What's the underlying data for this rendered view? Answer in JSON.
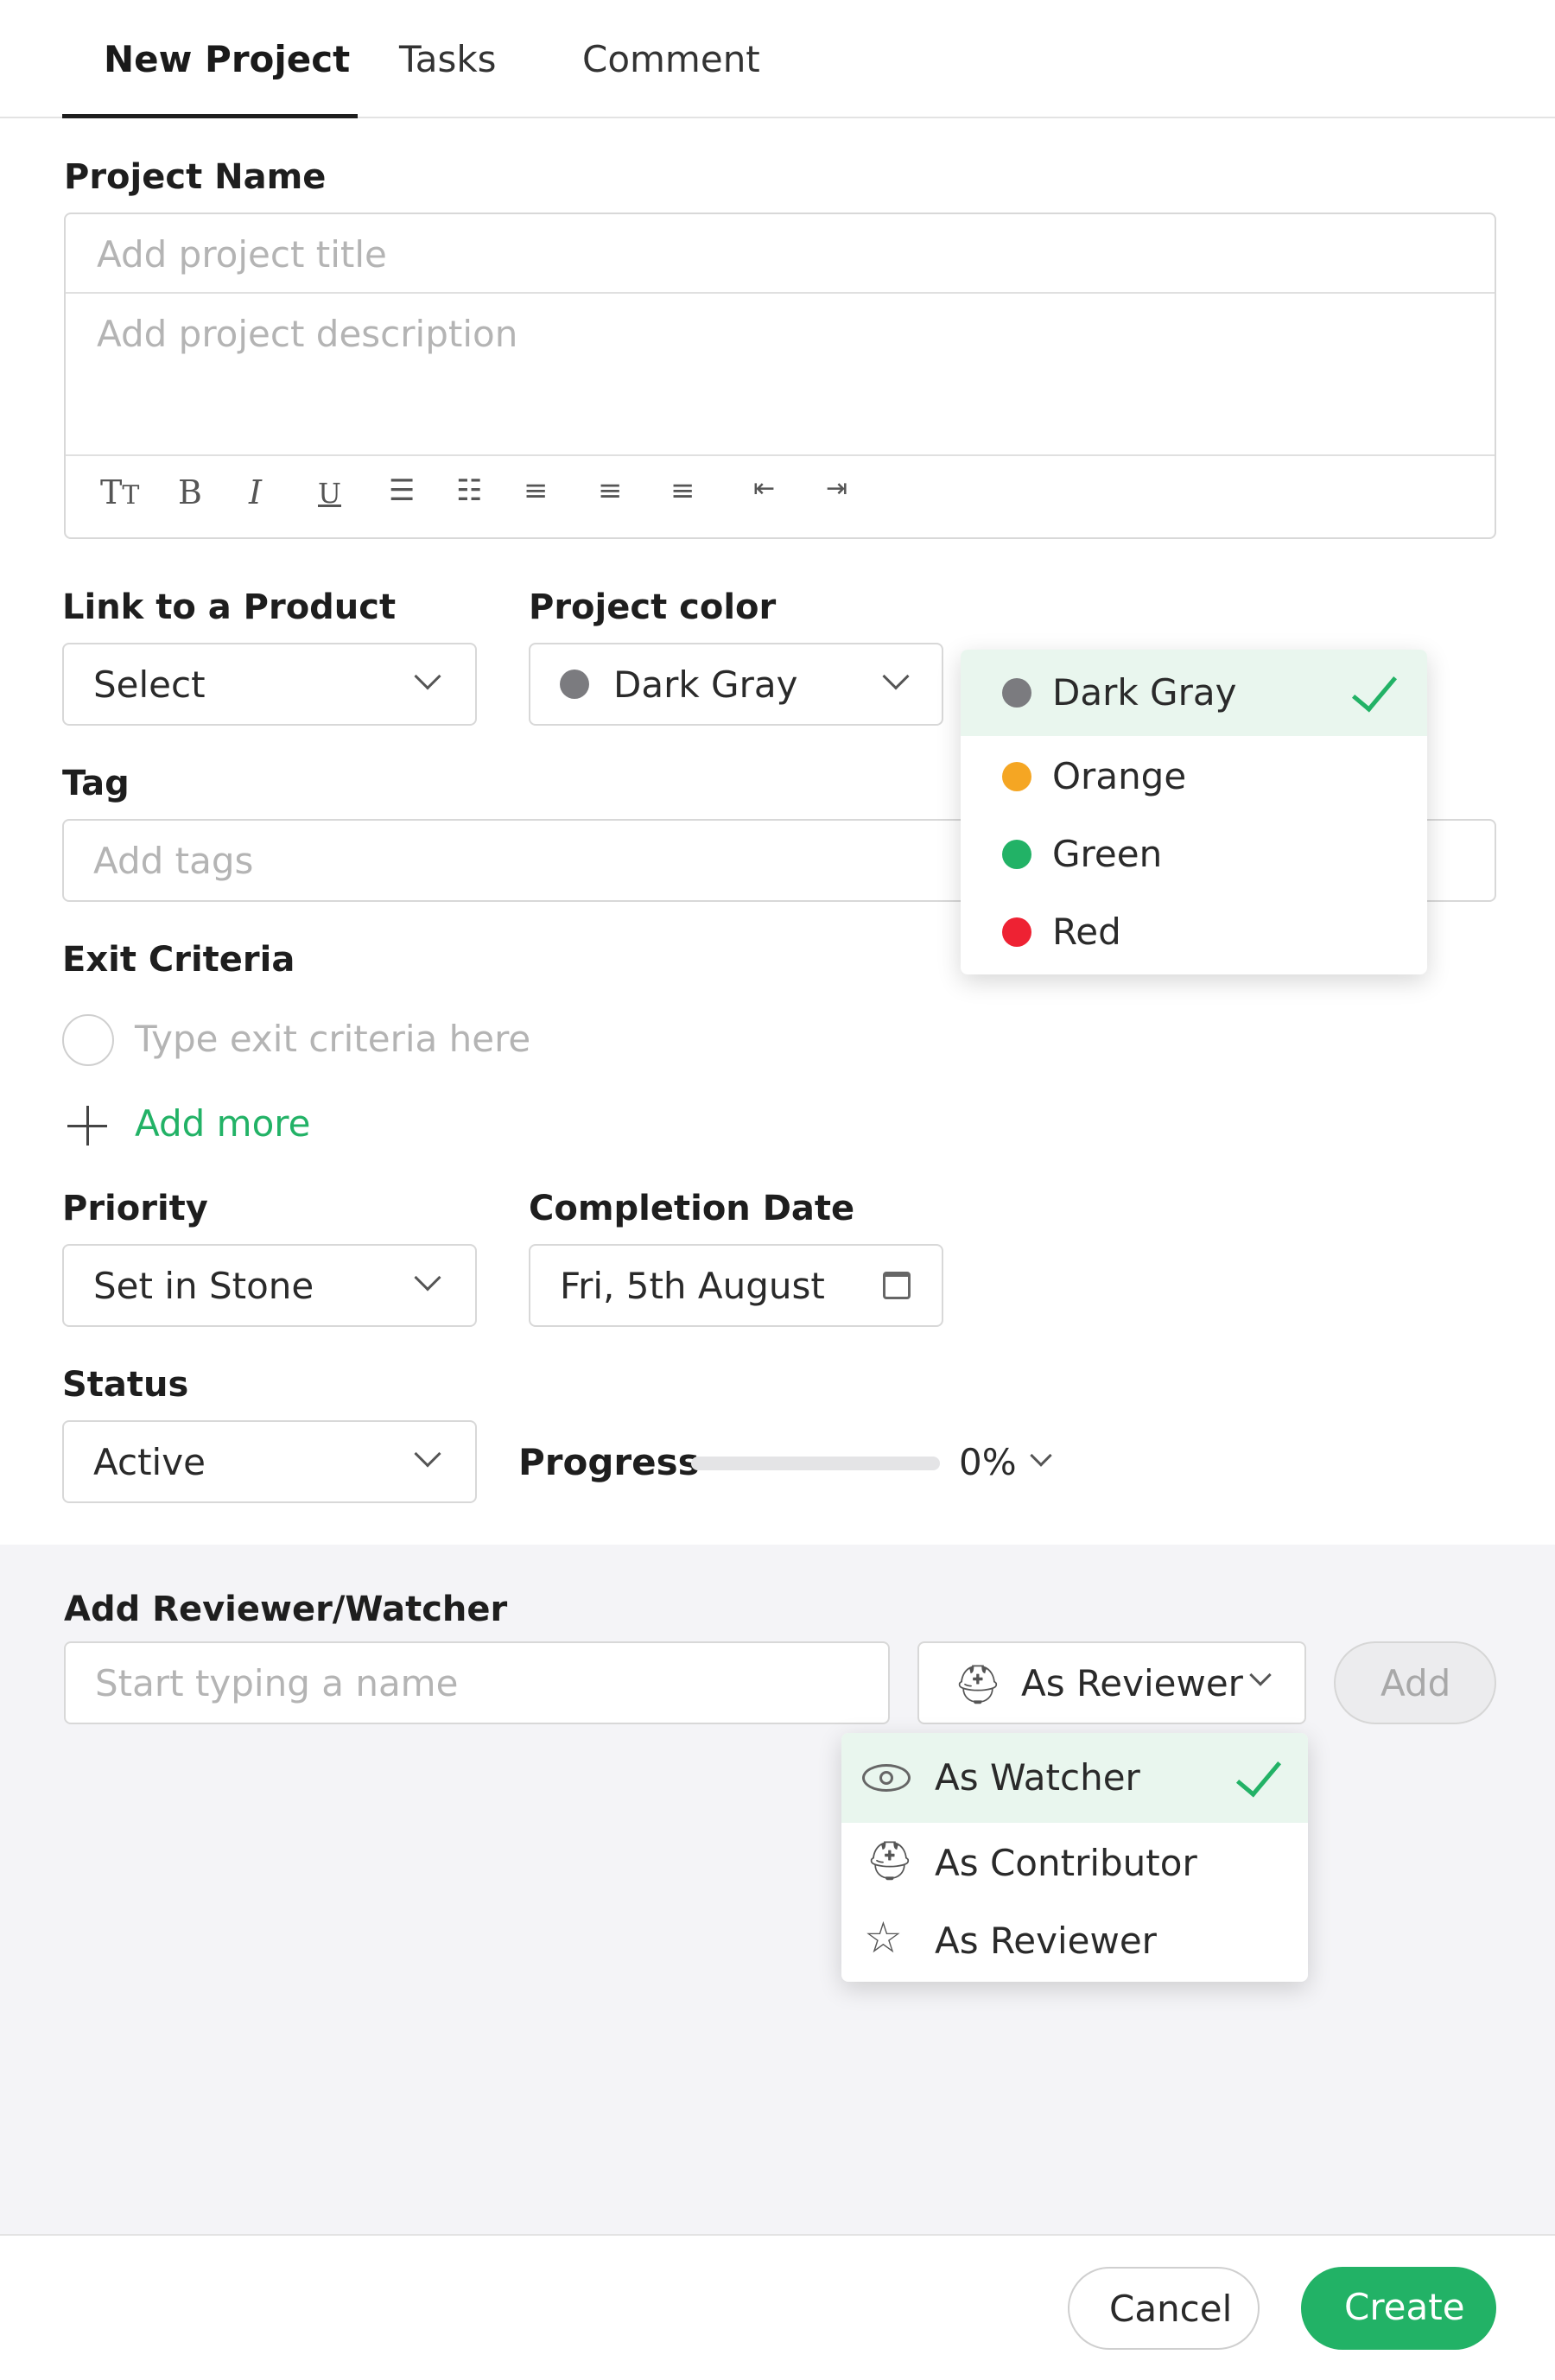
{
  "tabs": [
    {
      "label": "New Project",
      "active": true
    },
    {
      "label": "Tasks",
      "active": false
    },
    {
      "label": "Comment",
      "active": false
    }
  ],
  "project_name": {
    "label": "Project Name",
    "title_placeholder": "Add project title",
    "description_placeholder": "Add project description",
    "toolbar_icons": [
      "text-size",
      "bold",
      "italic",
      "underline",
      "numbered-list",
      "bulleted-list",
      "align-left",
      "align-center",
      "align-right",
      "indent-decrease",
      "indent-increase"
    ]
  },
  "link_product": {
    "label": "Link to a Product",
    "value": "Select"
  },
  "project_color": {
    "label": "Project color",
    "value": "Dark Gray",
    "value_color": "#7b7b7f",
    "options": [
      {
        "label": "Dark Gray",
        "color": "#7b7b7f",
        "selected": true
      },
      {
        "label": "Orange",
        "color": "#f5a623",
        "selected": false
      },
      {
        "label": "Green",
        "color": "#22b266",
        "selected": false
      },
      {
        "label": "Red",
        "color": "#ee2233",
        "selected": false
      }
    ]
  },
  "tag": {
    "label": "Tag",
    "placeholder": "Add tags"
  },
  "exit_criteria": {
    "label": "Exit Criteria",
    "placeholder": "Type exit criteria here",
    "add_more": "Add more"
  },
  "priority": {
    "label": "Priority",
    "value": "Set in Stone"
  },
  "completion_date": {
    "label": "Completion Date",
    "value": "Fri, 5th August"
  },
  "status": {
    "label": "Status",
    "value": "Active"
  },
  "progress": {
    "label": "Progress",
    "value_text": "0%",
    "fraction": 0
  },
  "reviewer": {
    "label": "Add Reviewer/Watcher",
    "placeholder": "Start typing a name",
    "role_value": "As Reviewer",
    "add_button": "Add",
    "role_options": [
      {
        "label": "As Watcher",
        "icon": "eye-icon",
        "selected": true
      },
      {
        "label": "As Contributor",
        "icon": "worker-icon",
        "selected": false
      },
      {
        "label": "As Reviewer",
        "icon": "star-icon",
        "selected": false
      }
    ]
  },
  "footer": {
    "cancel": "Cancel",
    "create": "Create"
  },
  "colors": {
    "accent": "#22b266",
    "panel_bg": "#f4f4f7",
    "selected_row_bg": "#e9f6ee"
  }
}
